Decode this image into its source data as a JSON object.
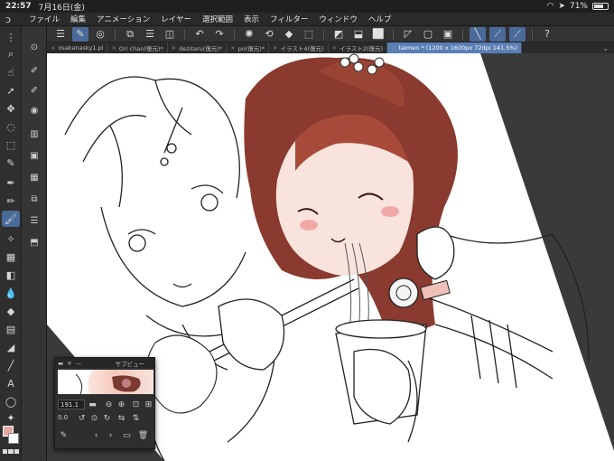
{
  "status_bar": {
    "time": "22:57",
    "date": "7月16日(金)",
    "battery": "71%",
    "battery_level": 0.71
  },
  "menu": {
    "items": [
      "ファイル",
      "編集",
      "アニメーション",
      "レイヤー",
      "選択範囲",
      "表示",
      "フィルター",
      "ウィンドウ",
      "ヘルプ"
    ]
  },
  "tabs": [
    {
      "label": "osakanasky1.pi",
      "active": false
    },
    {
      "label": "Ori chan(復元)*",
      "active": false
    },
    {
      "label": "dezitaru(復元)*",
      "active": false
    },
    {
      "label": "po(復元)*",
      "active": false
    },
    {
      "label": "イラスト4(復元)",
      "active": false
    },
    {
      "label": "イラスト2(復元)",
      "active": false
    },
    {
      "label": "taimen * (1200 x 1600px 72dpi 141.5%)",
      "active": true
    }
  ],
  "subview": {
    "title": "サブビュー",
    "zoom": "191.1",
    "angle": "0.0"
  },
  "colors": {
    "main_color": "#e7a7a0",
    "sub_color": "#ffffff",
    "accent": "#4a6a9a"
  }
}
